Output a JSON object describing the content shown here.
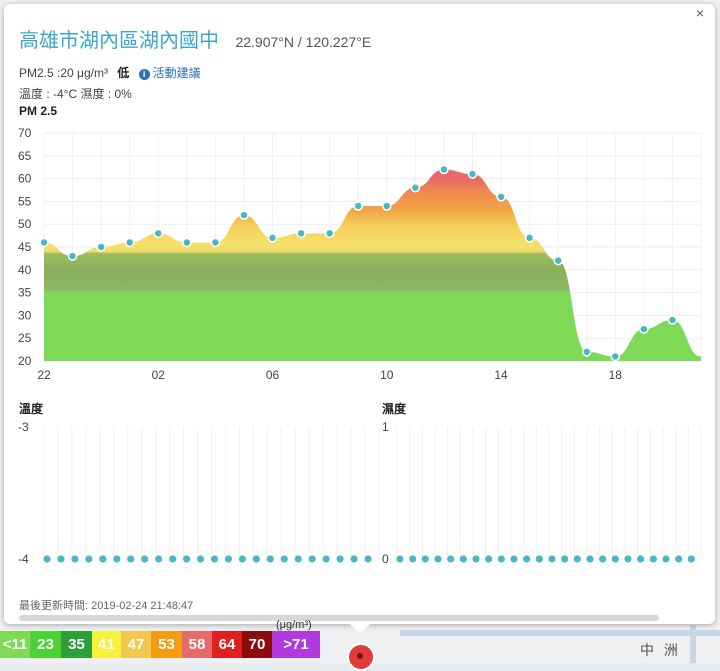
{
  "popup": {
    "close_label": "×",
    "title": "高雄市湖內區湖內國中",
    "coords": "22.907°N / 120.227°E",
    "pm25_text": "PM2.5 :20 μg/m³",
    "level": "低",
    "advice_label": "活動建議",
    "temp_humidity_text": "溫度 : -4°C 濕度 : 0%",
    "chart_title": "PM 2.5",
    "temp_title": "溫度",
    "humidity_title": "濕度",
    "updated_text": "最後更新時間: 2019-02-24 21:48:47",
    "colors": {
      "title": "#3ba7c9",
      "marker": "#4ab8c4"
    }
  },
  "chart_data": [
    {
      "type": "area",
      "title": "PM 2.5",
      "ylim": [
        20,
        70
      ],
      "yticks": [
        20,
        25,
        30,
        35,
        40,
        45,
        50,
        55,
        60,
        65,
        70
      ],
      "xtick_labels": [
        "22",
        "02",
        "06",
        "10",
        "14",
        "18"
      ],
      "x_hours": [
        22,
        23,
        0,
        1,
        2,
        3,
        4,
        5,
        6,
        7,
        8,
        9,
        10,
        11,
        12,
        13,
        14,
        15,
        16,
        17,
        18,
        19,
        20
      ],
      "values": [
        46,
        43,
        45,
        46,
        48,
        46,
        46,
        52,
        47,
        48,
        48,
        54,
        54,
        58,
        62,
        61,
        56,
        47,
        42,
        22,
        21,
        27,
        29
      ],
      "end_value": 21,
      "grid": true
    },
    {
      "type": "scatter",
      "title": "溫度",
      "y_top_label": "-3",
      "y_bottom_label": "-4",
      "value": -4,
      "points": 24
    },
    {
      "type": "scatter",
      "title": "濕度",
      "y_top_label": "1",
      "y_bottom_label": "0",
      "value": 0,
      "points": 24
    }
  ],
  "legend": {
    "unit": "(μg/m³)",
    "items": [
      {
        "label": "<11",
        "bg": "#7ed957",
        "fg": "#ffffff"
      },
      {
        "label": "23",
        "bg": "#4cd137",
        "fg": "#ffffff"
      },
      {
        "label": "35",
        "bg": "#2e9e3b",
        "fg": "#ffffff"
      },
      {
        "label": "41",
        "bg": "#f6f23c",
        "fg": "#ffffff"
      },
      {
        "label": "47",
        "bg": "#f2c94c",
        "fg": "#ffffff"
      },
      {
        "label": "53",
        "bg": "#f39c12",
        "fg": "#ffffff"
      },
      {
        "label": "58",
        "bg": "#e66a6a",
        "fg": "#ffffff"
      },
      {
        "label": "64",
        "bg": "#e02020",
        "fg": "#ffffff"
      },
      {
        "label": "70",
        "bg": "#8b0c0c",
        "fg": "#ffffff"
      },
      {
        "label": ">71",
        "bg": "#b03ae0",
        "fg": "#ffffff"
      }
    ]
  },
  "map": {
    "label": "中 洲"
  }
}
